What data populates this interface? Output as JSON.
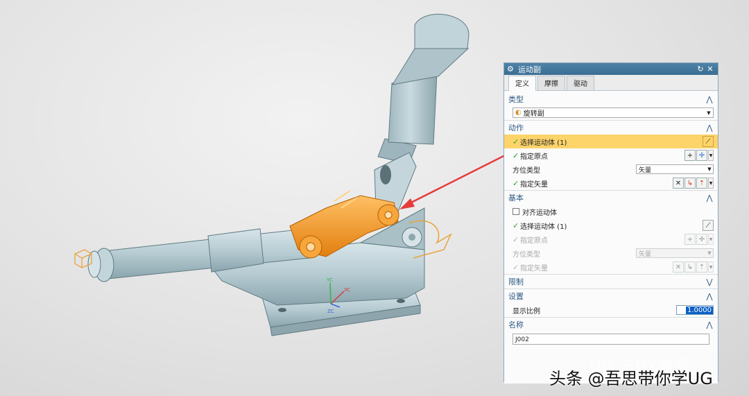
{
  "dialog": {
    "title": "运动副",
    "icon": "gear-icon",
    "tabs": [
      {
        "label": "定义",
        "active": true
      },
      {
        "label": "摩擦",
        "active": false
      },
      {
        "label": "驱动",
        "active": false
      }
    ],
    "type_section": {
      "header": "类型",
      "selected": "旋转副"
    },
    "action_section": {
      "header": "动作",
      "select_body": "选择运动体 (1)",
      "specify_origin": "指定原点",
      "orient_type_label": "方位类型",
      "orient_type_value": "矢量",
      "specify_vector": "指定矢量"
    },
    "base_section": {
      "header": "基本",
      "align_body": "对齐运动体",
      "select_body": "选择运动体 (1)",
      "specify_origin": "指定原点",
      "orient_type_label": "方位类型",
      "orient_type_value": "矢量",
      "specify_vector": "指定矢量"
    },
    "limit_section": {
      "header": "限制"
    },
    "settings_section": {
      "header": "设置",
      "display_scale_label": "显示比例",
      "display_scale_value": "1.0000"
    },
    "name_section": {
      "header": "名称",
      "name_value": "J002"
    }
  },
  "axis_labels": {
    "x": "XC",
    "y": "YC",
    "z": "ZC"
  },
  "watermark": {
    "overlay": "UG 三UX教程",
    "caption": "头条 @吾思带你学UG"
  },
  "colors": {
    "highlight": "#fdd46a",
    "title_bar": "#3a6d92",
    "part_gray": "#b9cdd3",
    "selected_orange": "#f39a2c",
    "arrow_red": "#e53c3c"
  }
}
